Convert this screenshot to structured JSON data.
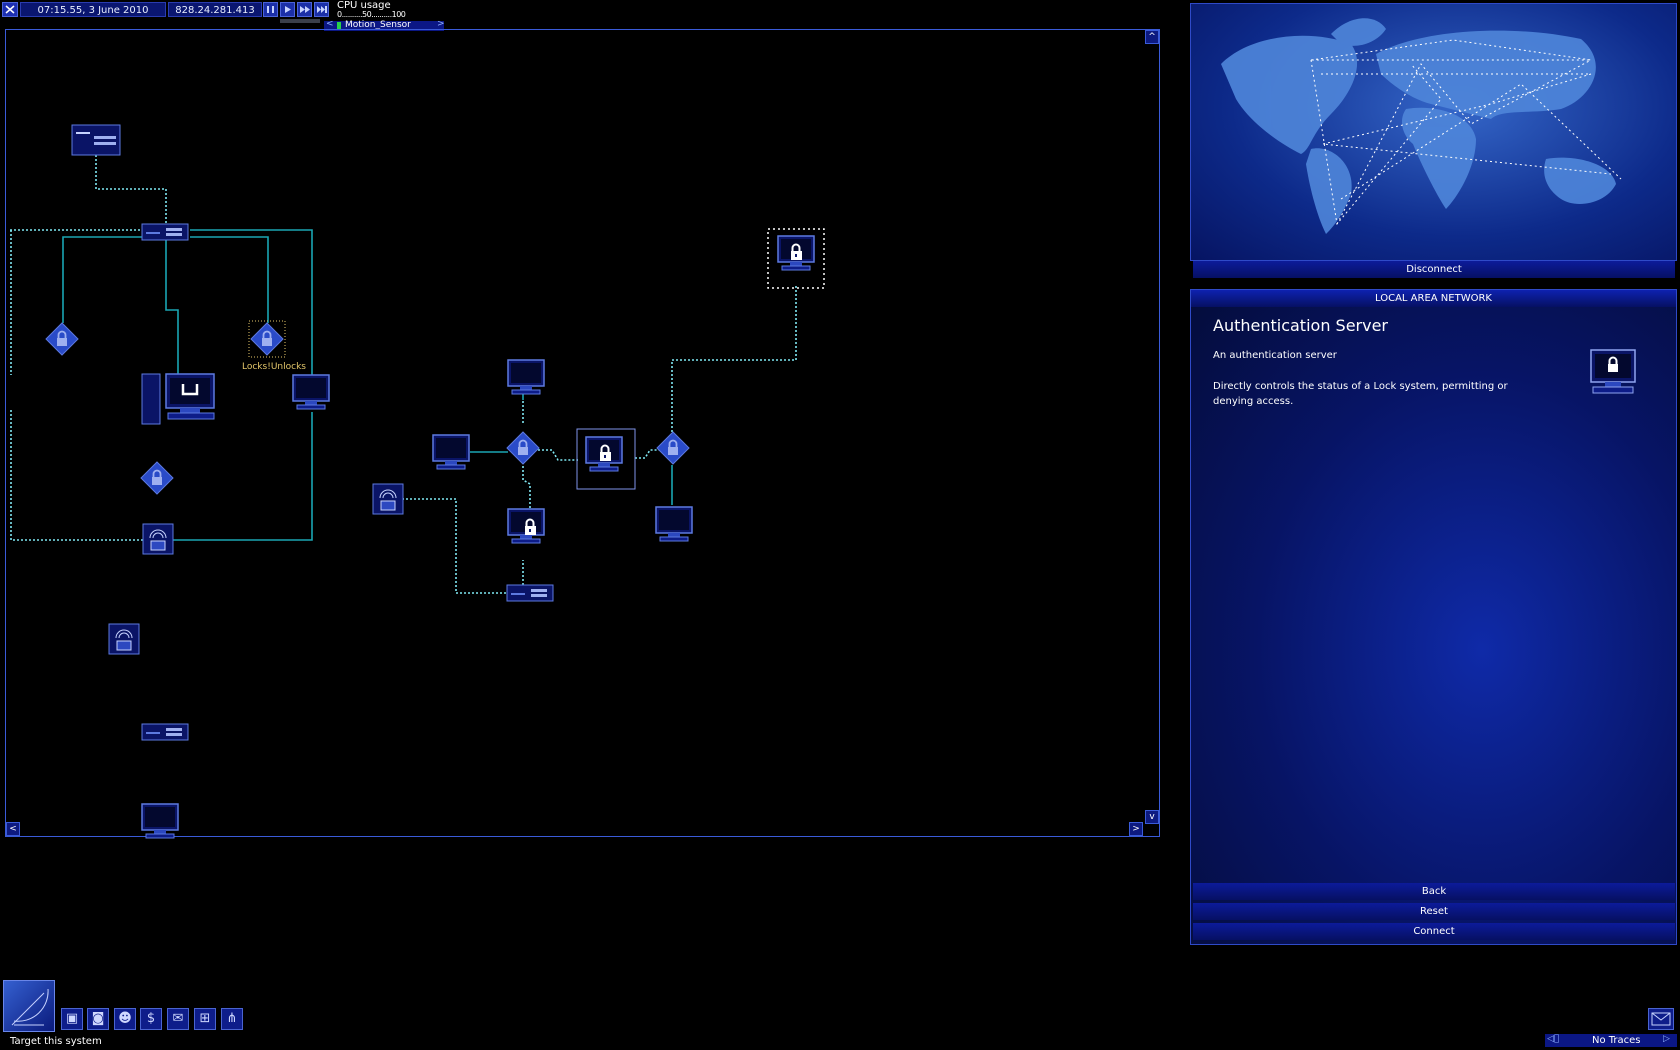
{
  "top_bar": {
    "datetime": "07:15.55, 3 June 2010",
    "ip": "828.24.281.413",
    "cpu_label": "CPU usage",
    "cpu_scale": "0..........50..........100",
    "cpu_fill_fraction": 0.04,
    "task_label": "Motion_Sensor"
  },
  "lan": {
    "node_label": "Locks!Unlocks"
  },
  "world_map": {
    "disconnect_label": "Disconnect"
  },
  "info_panel": {
    "header": "LOCAL AREA NETWORK",
    "title": "Authentication Server",
    "subtitle": "An authentication server",
    "description": "Directly controls the status of a Lock system, permitting or denying access.",
    "icon": "lock-computer-icon"
  },
  "buttons": {
    "back": "Back",
    "reset": "Reset",
    "connect": "Connect"
  },
  "status_bar": {
    "hint": "Target this system",
    "traces": "No Traces"
  },
  "colors": {
    "link": "#19a6b3",
    "node": "#2a4bc8",
    "accent": "#0b1785"
  }
}
